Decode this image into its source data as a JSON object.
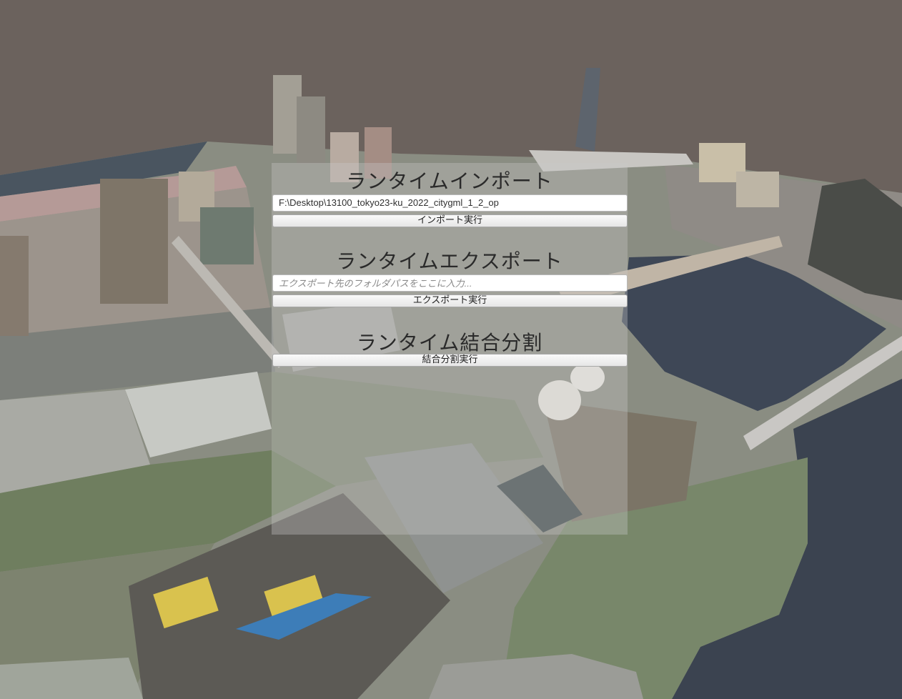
{
  "colors": {
    "sky": "#6b625d",
    "water": "#3f4754",
    "panel_overlay": "rgba(200,200,200,0.35)"
  },
  "scene": {
    "description_icon": "city-3d-model-icon"
  },
  "import_section": {
    "title": "ランタイムインポート",
    "path_value": "F:\\Desktop\\13100_tokyo23-ku_2022_citygml_1_2_op",
    "button_label": "インポート実行"
  },
  "export_section": {
    "title": "ランタイムエクスポート",
    "path_placeholder": "エクスポート先のフォルダパスをここに入力...",
    "button_label": "エクスポート実行"
  },
  "granularity_section": {
    "title": "ランタイム結合分割",
    "button_label": "結合分割実行"
  }
}
